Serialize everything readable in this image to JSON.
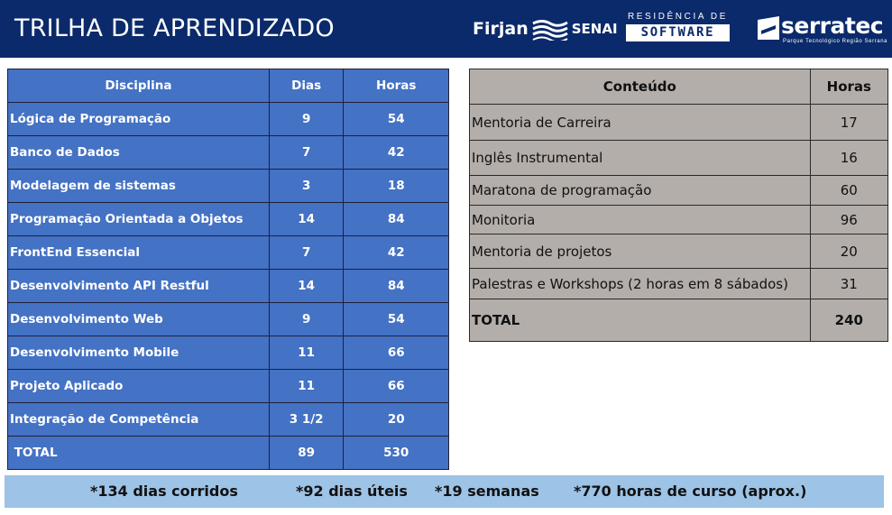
{
  "header": {
    "title": "TRILHA DE APRENDIZADO",
    "logos": {
      "firjan": "Firjan",
      "senai": "SENAI",
      "residencia_top": "RESIDÊNCIA DE",
      "residencia_box": "SOFTWARE",
      "serratec": "serratec",
      "serratec_sub": "Parque Tecnológico Região Serrana"
    }
  },
  "colors": {
    "header_bg": "#0b2a6b",
    "left_table_bg": "#4472c4",
    "right_table_bg": "#b4aeaa",
    "footer_bg": "#9dc3e6"
  },
  "left_table": {
    "headers": [
      "Disciplina",
      "Dias",
      "Horas"
    ],
    "rows": [
      {
        "disciplina": "Lógica de Programação",
        "dias": "9",
        "horas": "54"
      },
      {
        "disciplina": "Banco de Dados",
        "dias": "7",
        "horas": "42"
      },
      {
        "disciplina": "Modelagem de sistemas",
        "dias": "3",
        "horas": "18"
      },
      {
        "disciplina": "Programação Orientada a Objetos",
        "dias": "14",
        "horas": "84"
      },
      {
        "disciplina": "FrontEnd Essencial",
        "dias": "7",
        "horas": "42"
      },
      {
        "disciplina": "Desenvolvimento API Restful",
        "dias": "14",
        "horas": "84"
      },
      {
        "disciplina": "Desenvolvimento Web",
        "dias": "9",
        "horas": "54"
      },
      {
        "disciplina": "Desenvolvimento Mobile",
        "dias": "11",
        "horas": "66"
      },
      {
        "disciplina": "Projeto Aplicado",
        "dias": "11",
        "horas": "66"
      },
      {
        "disciplina": "Integração de Competência",
        "dias": "3 1/2",
        "horas": "20"
      }
    ],
    "total": {
      "label": " TOTAL",
      "dias": "89",
      "horas": "530"
    }
  },
  "right_table": {
    "headers": [
      "Conteúdo",
      "Horas"
    ],
    "rows": [
      {
        "conteudo": "Mentoria de Carreira",
        "horas": "17"
      },
      {
        "conteudo": "Inglês Instrumental",
        "horas": "16"
      },
      {
        "conteudo": "Maratona de programação",
        "horas": "60"
      },
      {
        "conteudo": "Monitoria",
        "horas": "96"
      },
      {
        "conteudo": "Mentoria de projetos",
        "horas": "20"
      },
      {
        "conteudo": "Palestras e Workshops (2 horas em 8 sábados)",
        "horas": "31"
      }
    ],
    "total": {
      "label": "TOTAL",
      "horas": "240"
    }
  },
  "footer": {
    "dias_corridos": "*134 dias corridos",
    "dias_uteis": "*92 dias úteis",
    "semanas": "*19 semanas",
    "horas_curso": "*770 horas de curso (aprox.)"
  }
}
